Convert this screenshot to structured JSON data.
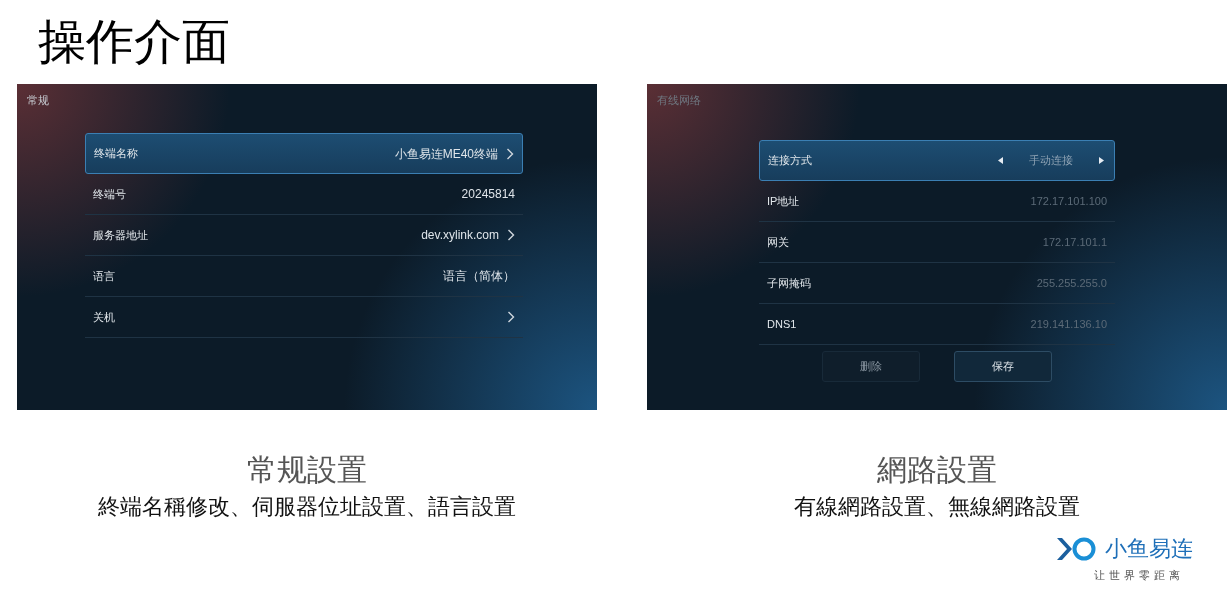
{
  "title": "操作介面",
  "screens": [
    {
      "header": "常规",
      "rows": [
        {
          "kind": "link",
          "label": "终端名称",
          "value": "小鱼易连ME40终端",
          "selected": true
        },
        {
          "kind": "plain",
          "label": "终端号",
          "value": "20245814",
          "selected": false
        },
        {
          "kind": "link",
          "label": "服务器地址",
          "value": "dev.xylink.com",
          "selected": false
        },
        {
          "kind": "plain",
          "label": "语言",
          "value": "语言（简体）",
          "selected": false
        },
        {
          "kind": "link",
          "label": "关机",
          "selected": false
        }
      ],
      "caption": "常规設置",
      "description": "終端名稱修改、伺服器位址設置、語言設置"
    },
    {
      "header": "有线网络",
      "rows": [
        {
          "kind": "selector",
          "label": "连接方式",
          "value": "手动连接",
          "selected": true
        },
        {
          "kind": "field",
          "label": "IP地址",
          "value": "172.17.101.100",
          "selected": false
        },
        {
          "kind": "field",
          "label": "网关",
          "value": "172.17.101.1",
          "selected": false
        },
        {
          "kind": "field",
          "label": "子网掩码",
          "value": "255.255.255.0",
          "selected": false
        },
        {
          "kind": "field",
          "label": "DNS1",
          "value": "219.141.136.10",
          "selected": false
        }
      ],
      "buttons": [
        {
          "label": "删除",
          "selected": false
        },
        {
          "label": "保存",
          "selected": true
        }
      ],
      "caption": "網路設置",
      "description": "有線網路設置、無線網路設置"
    }
  ],
  "logo": {
    "name": "小鱼易连",
    "tagline": "让世界零距离"
  }
}
